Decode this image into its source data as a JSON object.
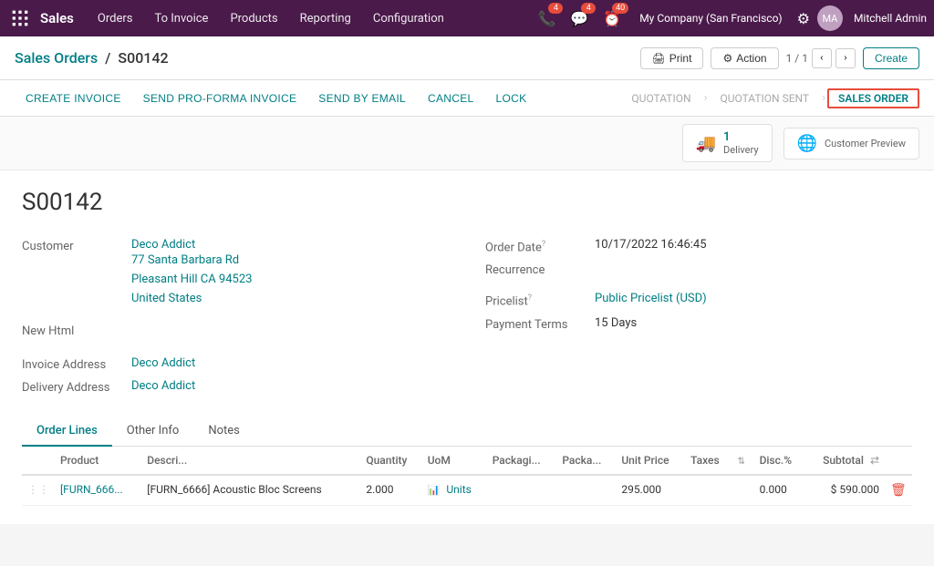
{
  "app": {
    "name": "Sales",
    "nav_items": [
      "Orders",
      "To Invoice",
      "Products",
      "Reporting",
      "Configuration"
    ]
  },
  "nav": {
    "icons": {
      "phone_badge": "4",
      "clock_badge": "40"
    },
    "company": "My Company (San Francisco)",
    "user": "Mitchell Admin"
  },
  "breadcrumb": {
    "parent": "Sales Orders",
    "separator": "/",
    "current": "S00142",
    "print_label": "Print",
    "action_label": "Action",
    "pager": "1 / 1",
    "create_label": "Create"
  },
  "action_bar": {
    "buttons": [
      "CREATE INVOICE",
      "SEND PRO-FORMA INVOICE",
      "SEND BY EMAIL",
      "CANCEL",
      "LOCK"
    ]
  },
  "status_bar": {
    "steps": [
      "QUOTATION",
      "QUOTATION SENT",
      "SALES ORDER"
    ],
    "active_step": "SALES ORDER"
  },
  "smart_buttons": {
    "delivery": {
      "count": "1",
      "label": "Delivery"
    },
    "customer_preview": {
      "label": "Customer Preview"
    }
  },
  "order": {
    "title": "S00142",
    "customer_label": "Customer",
    "customer_name": "Deco Addict",
    "customer_address_line1": "77 Santa Barbara Rd",
    "customer_address_line2": "Pleasant Hill CA 94523",
    "customer_address_line3": "United States",
    "new_html_label": "New Html",
    "invoice_address_label": "Invoice Address",
    "invoice_address": "Deco Addict",
    "delivery_address_label": "Delivery Address",
    "delivery_address": "Deco Addict",
    "order_date_label": "Order Date",
    "order_date_superscript": "?",
    "order_date": "10/17/2022 16:46:45",
    "recurrence_label": "Recurrence",
    "pricelist_label": "Pricelist",
    "pricelist_superscript": "?",
    "pricelist": "Public Pricelist (USD)",
    "payment_terms_label": "Payment Terms",
    "payment_terms": "15 Days"
  },
  "tabs": {
    "items": [
      "Order Lines",
      "Other Info",
      "Notes"
    ],
    "active": "Order Lines"
  },
  "table": {
    "headers": [
      "Product",
      "Descri...",
      "Quantity",
      "UoM",
      "Packagi...",
      "Packa...",
      "Unit Price",
      "Taxes",
      "",
      "Disc.%",
      "Subtotal"
    ],
    "rows": [
      {
        "product_code": "[FURN_666...",
        "product_name": "[FURN_6666] Acoustic Bloc Screens",
        "quantity": "2.000",
        "uom": "Units",
        "packaging_desc": "",
        "packaging": "",
        "unit_price": "295.000",
        "taxes": "",
        "disc": "0.000",
        "subtotal": "$ 590.000"
      }
    ]
  }
}
